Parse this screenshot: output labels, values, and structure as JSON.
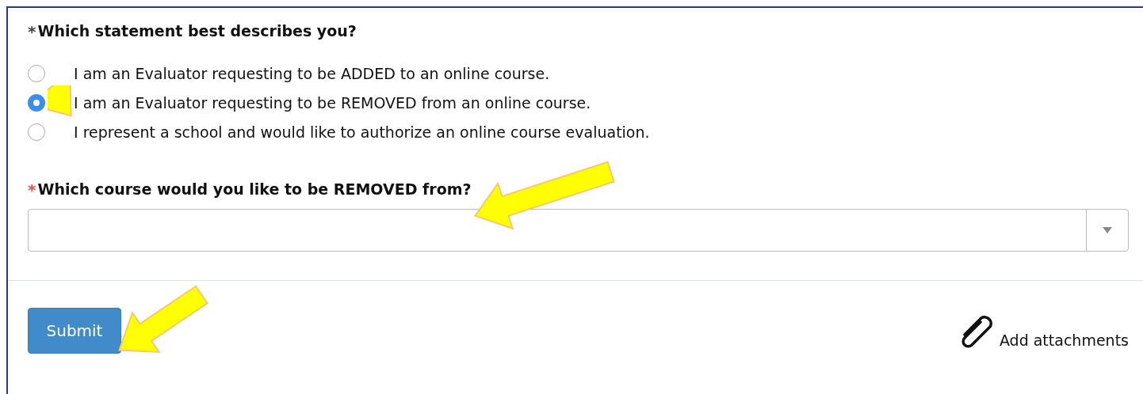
{
  "question": {
    "required_mark": "*",
    "label": "Which statement best describes you?"
  },
  "options": [
    {
      "label": "I am an Evaluator requesting to be ADDED to an online course.",
      "selected": false
    },
    {
      "label": "I am an Evaluator requesting to be REMOVED from an online course.",
      "selected": true
    },
    {
      "label": "I represent a school and would like to authorize an online course evaluation.",
      "selected": false
    }
  ],
  "course_question": {
    "required_mark": "*",
    "label": "Which course would you like to be REMOVED from?"
  },
  "submit_button": "Submit",
  "attachments_link": "Add attachments"
}
